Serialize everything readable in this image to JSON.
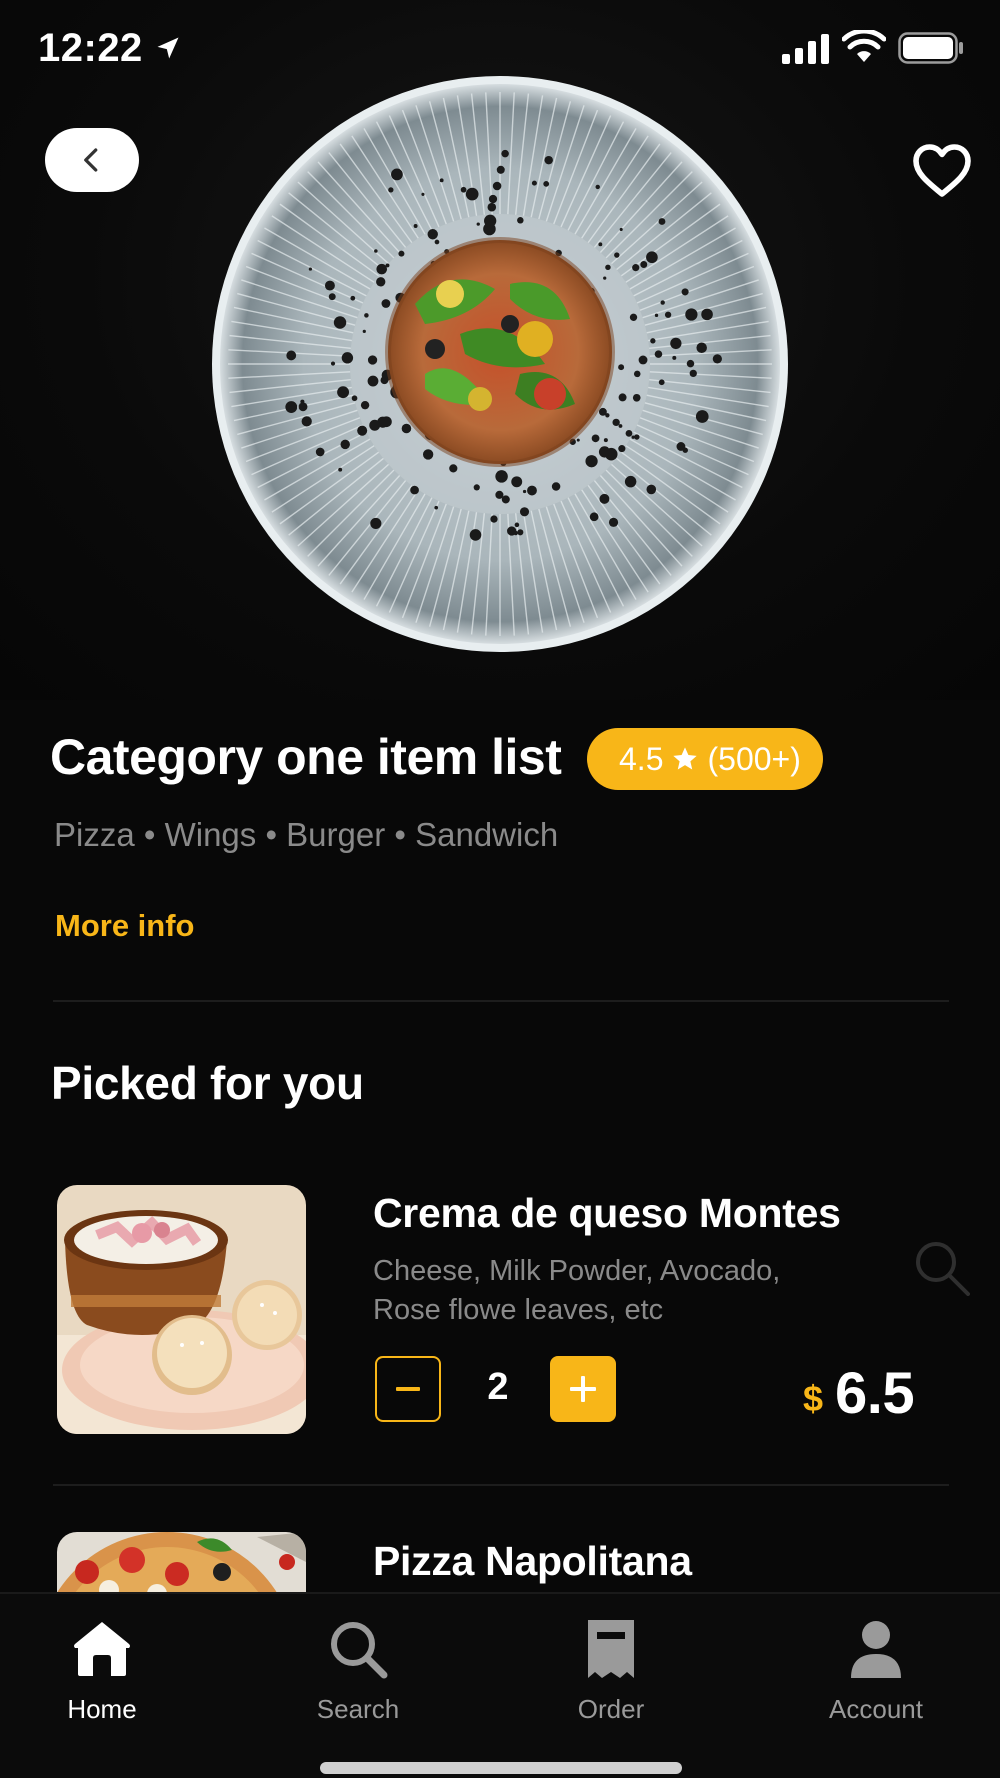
{
  "status": {
    "time": "12:22"
  },
  "header": {
    "back_icon": "chevron-left-icon",
    "favorite_icon": "heart-outline-icon"
  },
  "restaurant": {
    "title": "Category one item list",
    "rating": "4.5",
    "reviews": "(500+)",
    "tags": "Pizza • Wings • Burger • Sandwich",
    "more_info_label": "More info"
  },
  "section": {
    "title": "Picked for you"
  },
  "items": [
    {
      "name": "Crema de queso Montes",
      "description_line1": "Cheese, Milk Powder, Avocado,",
      "description_line2": "Rose flowe leaves, etc",
      "quantity": "2",
      "currency": "$",
      "price": "6.5"
    },
    {
      "name": "Pizza Napolitana"
    }
  ],
  "tab_bar": {
    "tabs": [
      {
        "label": "Home",
        "icon": "home-icon",
        "active": true
      },
      {
        "label": "Search",
        "icon": "search-icon",
        "active": false
      },
      {
        "label": "Order",
        "icon": "receipt-icon",
        "active": false
      },
      {
        "label": "Account",
        "icon": "user-icon",
        "active": false
      }
    ]
  },
  "colors": {
    "accent": "#f8b618",
    "background": "#080808",
    "muted": "#8a8a8a"
  }
}
